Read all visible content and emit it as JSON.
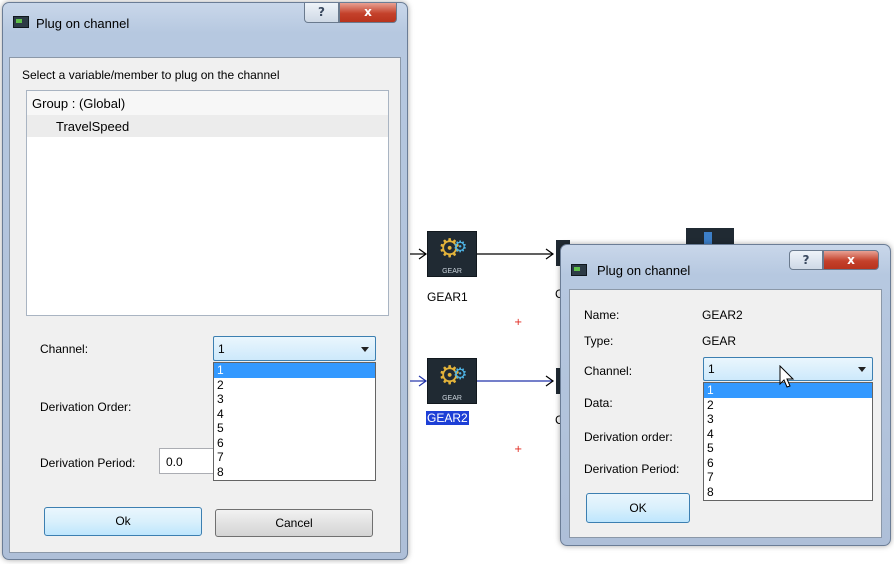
{
  "left_dialog": {
    "title": "Plug on channel",
    "help_label": "?",
    "close_label": "x",
    "instruction": "Select a variable/member to plug on the channel",
    "tree": {
      "group": "Group : (Global)",
      "items": [
        "TravelSpeed"
      ]
    },
    "channel_label": "Channel:",
    "channel_value": "1",
    "derivation_order_label": "Derivation Order:",
    "derivation_period_label": "Derivation Period:",
    "derivation_period_value": "0.0",
    "options": [
      "1",
      "2",
      "3",
      "4",
      "5",
      "6",
      "7",
      "8"
    ],
    "ok_label": "Ok",
    "cancel_label": "Cancel"
  },
  "diagram": {
    "blocks": [
      {
        "label": "GEAR1",
        "icon_text": "GEAR"
      },
      {
        "label": "GEAR2",
        "icon_text": "GEAR"
      }
    ],
    "partial_labels": [
      "C",
      "C"
    ],
    "plus_marks": [
      "+",
      "+"
    ]
  },
  "right_dialog": {
    "title": "Plug on channel",
    "help_label": "?",
    "close_label": "x",
    "name_label": "Name:",
    "name_value": "GEAR2",
    "type_label": "Type:",
    "type_value": "GEAR",
    "channel_label": "Channel:",
    "channel_value": "1",
    "data_label": "Data:",
    "derivation_order_label": "Derivation order:",
    "derivation_period_label": "Derivation Period:",
    "options": [
      "1",
      "2",
      "3",
      "4",
      "5",
      "6",
      "7",
      "8"
    ],
    "ok_label": "OK"
  },
  "colors": {
    "selection": "#3399ff",
    "selected_block_label": "#1d3fd6",
    "connector": "#2233aa",
    "plus_mark": "#e0241b"
  }
}
